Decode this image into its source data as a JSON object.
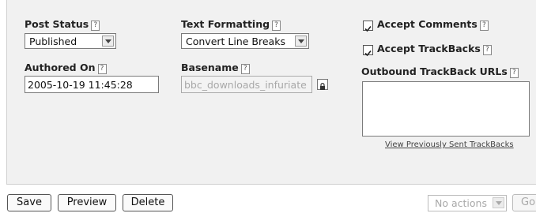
{
  "post_status": {
    "label": "Post Status",
    "help": "?",
    "value": "Published"
  },
  "text_formatting": {
    "label": "Text Formatting",
    "help": "?",
    "value": "Convert Line Breaks"
  },
  "accept_comments": {
    "label": "Accept Comments",
    "help": "?",
    "checked": true
  },
  "accept_trackbacks": {
    "label": "Accept TrackBacks",
    "help": "?",
    "checked": true
  },
  "authored_on": {
    "label": "Authored On",
    "help": "?",
    "value": "2005-10-19 11:45:28"
  },
  "basename": {
    "label": "Basename",
    "help": "?",
    "value": "bbc_downloads_infuriate"
  },
  "outbound_trackbacks": {
    "label": "Outbound TrackBack URLs",
    "help": "?",
    "value": ""
  },
  "view_sent_trackbacks": "View Previously Sent TrackBacks",
  "buttons": {
    "save": "Save",
    "preview": "Preview",
    "delete": "Delete",
    "go": "Go"
  },
  "actions_select": {
    "value": "No actions"
  }
}
